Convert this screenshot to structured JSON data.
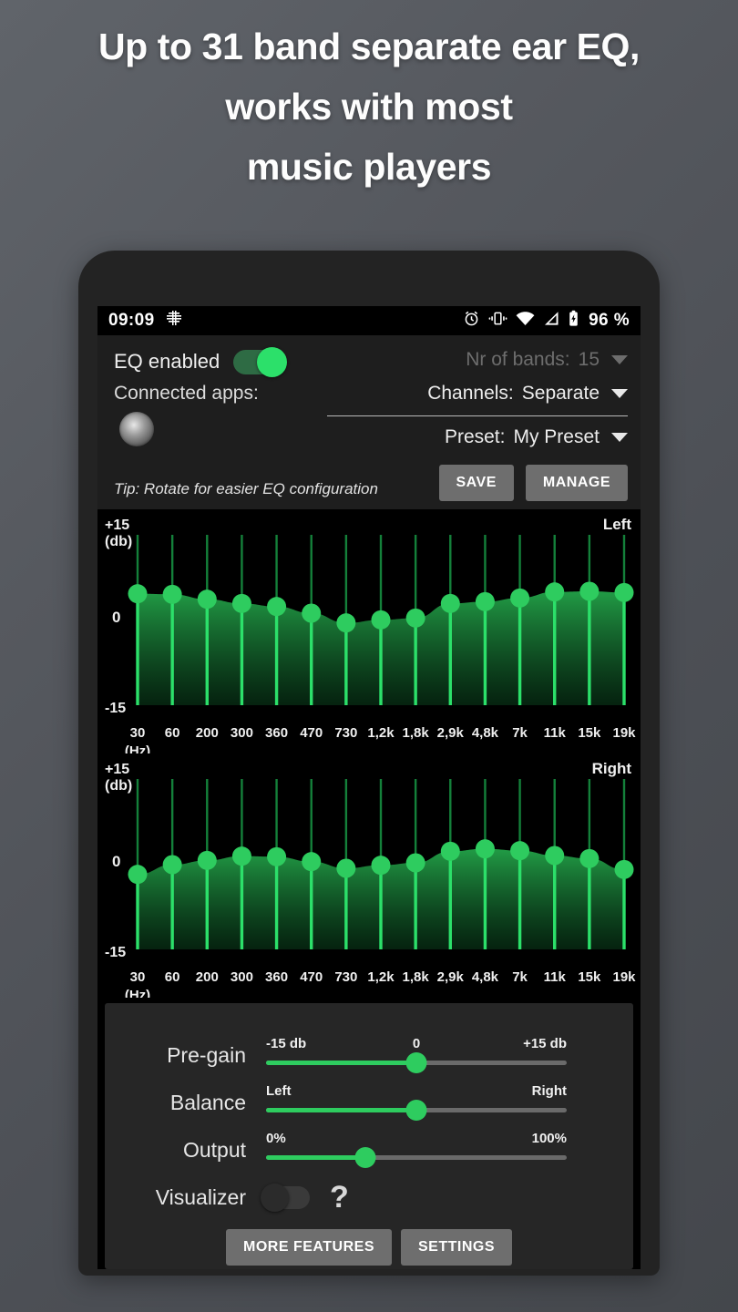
{
  "headline": {
    "lines": [
      "Up to 31 band separate ear EQ,",
      "works with most",
      "music players"
    ]
  },
  "statusbar": {
    "time": "09:09",
    "app_icon": "equalizer-icon",
    "icons": [
      "alarm-icon",
      "vibrate-icon",
      "wifi-icon",
      "signal-icon",
      "battery-charging-icon"
    ],
    "battery": "96 %"
  },
  "top": {
    "eq_enabled_label": "EQ enabled",
    "eq_enabled_state": "on",
    "connected_apps_label": "Connected apps:",
    "app_icon_name": "connected-app-icon",
    "tip": "Tip: Rotate for easier EQ configuration",
    "bands_label": "Nr of bands:",
    "bands_value": "15",
    "channels_label": "Channels:",
    "channels_value": "Separate",
    "preset_label": "Preset:",
    "preset_value": "My Preset",
    "save_label": "SAVE",
    "manage_label": "MANAGE"
  },
  "chart_data": [
    {
      "type": "bar",
      "title": "Left",
      "ylabel": "+15 (db)",
      "ymin_label": "-15",
      "ymid_label": "0",
      "ymax_label": "+15",
      "yunit_label": "(db)",
      "xlabel": "(Hz)",
      "ylim": [
        -15,
        15
      ],
      "grid": false,
      "categories": [
        "30",
        "60",
        "200",
        "300",
        "360",
        "470",
        "730",
        "1,2k",
        "1,8k",
        "2,9k",
        "4,8k",
        "7k",
        "11k",
        "15k",
        "19k"
      ],
      "values": [
        3.8,
        3.7,
        2.9,
        2.2,
        1.7,
        0.6,
        -1.0,
        -0.5,
        -0.2,
        2.2,
        2.5,
        3.1,
        4.1,
        4.2,
        4.0
      ]
    },
    {
      "type": "bar",
      "title": "Right",
      "ylabel": "+15 (db)",
      "ymin_label": "-15",
      "ymid_label": "0",
      "ymax_label": "+15",
      "yunit_label": "(db)",
      "xlabel": "(Hz)",
      "ylim": [
        -15,
        15
      ],
      "grid": false,
      "categories": [
        "30",
        "60",
        "200",
        "300",
        "360",
        "470",
        "730",
        "1,2k",
        "1,8k",
        "2,9k",
        "4,8k",
        "7k",
        "11k",
        "15k",
        "19k"
      ],
      "values": [
        -2.2,
        -0.6,
        0.1,
        0.8,
        0.7,
        -0.1,
        -1.2,
        -0.7,
        -0.3,
        1.6,
        2.0,
        1.7,
        0.9,
        0.4,
        -1.4
      ]
    }
  ],
  "sliders": [
    {
      "name": "Pre-gain",
      "left": "-15 db",
      "mid": "0",
      "right": "+15 db",
      "percent": 50
    },
    {
      "name": "Balance",
      "left": "Left",
      "mid": "",
      "right": "Right",
      "percent": 50
    },
    {
      "name": "Output",
      "left": "0%",
      "mid": "",
      "right": "100%",
      "percent": 33
    }
  ],
  "bottom": {
    "visualizer_label": "Visualizer",
    "visualizer_state": "off",
    "help_label": "?",
    "more_features_label": "MORE FEATURES",
    "settings_label": "SETTINGS"
  },
  "colors": {
    "accent_green": "#2ecc5f",
    "bright_green": "#2ce06a",
    "panel": "#1e1e1e",
    "screen_bg": "#000000"
  }
}
